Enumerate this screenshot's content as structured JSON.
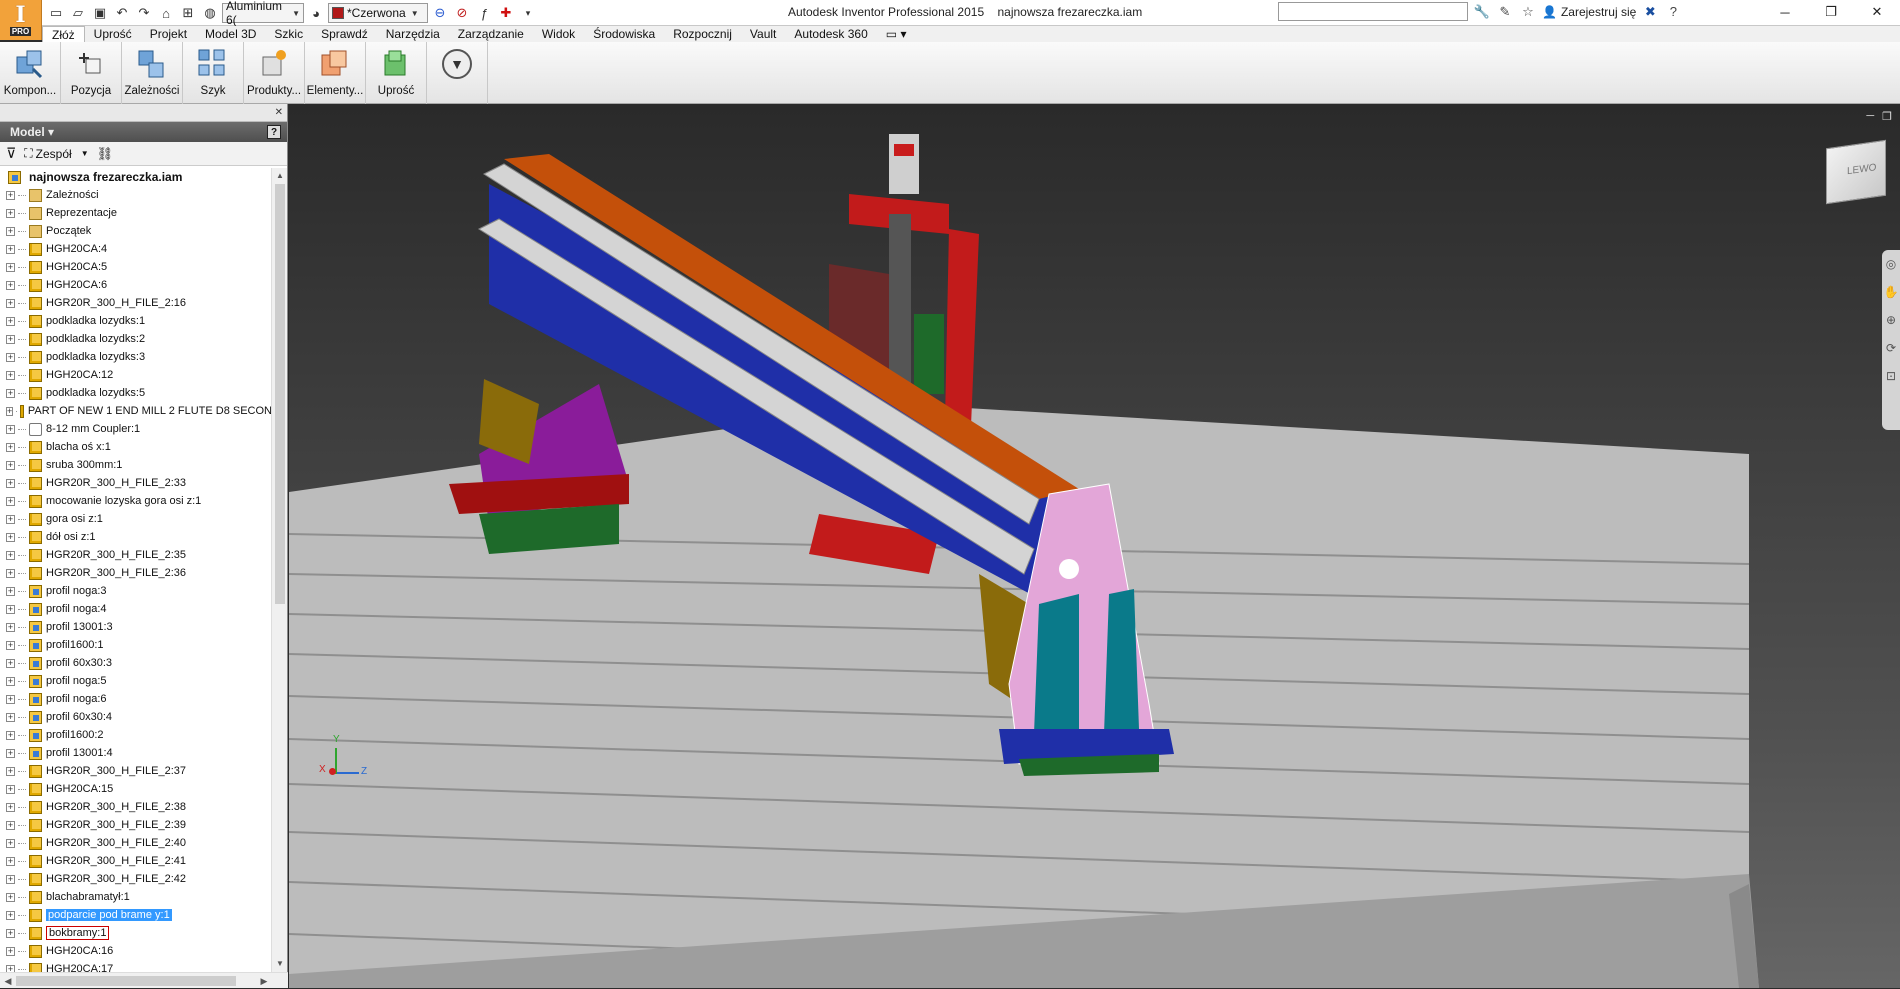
{
  "app": {
    "title": "Autodesk Inventor Professional 2015",
    "document": "najnowsza frezareczka.iam",
    "logo_letter": "I",
    "logo_badge": "PRO"
  },
  "quick_access": {
    "material": "Aluminium 6(",
    "appearance": "*Czerwona",
    "appearance_color": "#b01818"
  },
  "header_right": {
    "search_placeholder": "",
    "signin_label": "Zarejestruj się"
  },
  "menu_tabs": [
    "Złóż",
    "Uprość",
    "Projekt",
    "Model 3D",
    "Szkic",
    "Sprawdź",
    "Narzędzia",
    "Zarządzanie",
    "Widok",
    "Środowiska",
    "Rozpocznij",
    "Vault",
    "Autodesk 360"
  ],
  "active_tab": "Złóż",
  "ribbon": {
    "buttons": [
      {
        "label": "Kompon...",
        "icon": "component-icon"
      },
      {
        "label": "Pozycja",
        "icon": "position-icon"
      },
      {
        "label": "Zależności",
        "icon": "constraints-icon"
      },
      {
        "label": "Szyk",
        "icon": "pattern-icon"
      },
      {
        "label": "Produkty...",
        "icon": "productivity-icon"
      },
      {
        "label": "Elementy...",
        "icon": "features-icon"
      },
      {
        "label": "Uprość",
        "icon": "simplify-icon"
      }
    ]
  },
  "browser": {
    "title": "Model",
    "help": "?",
    "filter_label": "Zespół",
    "root": "najnowsza frezareczka.iam",
    "items": [
      {
        "label": "Zależności",
        "type": "folder"
      },
      {
        "label": "Reprezentacje",
        "type": "folder"
      },
      {
        "label": "Początek",
        "type": "folder"
      },
      {
        "label": "HGH20CA:4",
        "type": "box"
      },
      {
        "label": "HGH20CA:5",
        "type": "box"
      },
      {
        "label": "HGH20CA:6",
        "type": "box"
      },
      {
        "label": "HGR20R_300_H_FILE_2:16",
        "type": "box"
      },
      {
        "label": "podkladka lozydks:1",
        "type": "box"
      },
      {
        "label": "podkladka lozydks:2",
        "type": "box"
      },
      {
        "label": "podkladka lozydks:3",
        "type": "box"
      },
      {
        "label": "HGH20CA:12",
        "type": "box"
      },
      {
        "label": "podkladka lozydks:5",
        "type": "box"
      },
      {
        "label": "PART OF NEW 1 END MILL 2 FLUTE D8 SECON",
        "type": "box"
      },
      {
        "label": "8-12 mm Coupler:1",
        "type": "coupler"
      },
      {
        "label": "blacha oś x:1",
        "type": "box"
      },
      {
        "label": "sruba 300mm:1",
        "type": "box"
      },
      {
        "label": "HGR20R_300_H_FILE_2:33",
        "type": "box"
      },
      {
        "label": "mocowanie lozyska gora osi z:1",
        "type": "box"
      },
      {
        "label": "gora osi z:1",
        "type": "box"
      },
      {
        "label": "dół osi z:1",
        "type": "box"
      },
      {
        "label": "HGR20R_300_H_FILE_2:35",
        "type": "box"
      },
      {
        "label": "HGR20R_300_H_FILE_2:36",
        "type": "box"
      },
      {
        "label": "profil noga:3",
        "type": "asm"
      },
      {
        "label": "profil noga:4",
        "type": "asm"
      },
      {
        "label": "profil 13001:3",
        "type": "asm"
      },
      {
        "label": "profil1600:1",
        "type": "asm"
      },
      {
        "label": "profil 60x30:3",
        "type": "asm"
      },
      {
        "label": "profil noga:5",
        "type": "asm"
      },
      {
        "label": "profil noga:6",
        "type": "asm"
      },
      {
        "label": "profil 60x30:4",
        "type": "asm"
      },
      {
        "label": "profil1600:2",
        "type": "asm"
      },
      {
        "label": "profil 13001:4",
        "type": "asm"
      },
      {
        "label": "HGR20R_300_H_FILE_2:37",
        "type": "box"
      },
      {
        "label": "HGH20CA:15",
        "type": "box"
      },
      {
        "label": "HGR20R_300_H_FILE_2:38",
        "type": "box"
      },
      {
        "label": "HGR20R_300_H_FILE_2:39",
        "type": "box"
      },
      {
        "label": "HGR20R_300_H_FILE_2:40",
        "type": "box"
      },
      {
        "label": "HGR20R_300_H_FILE_2:41",
        "type": "box"
      },
      {
        "label": "HGR20R_300_H_FILE_2:42",
        "type": "box"
      },
      {
        "label": "blachabramatył:1",
        "type": "box"
      },
      {
        "label": "podparcie pod brame y:1",
        "type": "box",
        "state": "selected"
      },
      {
        "label": "bokbramy:1",
        "type": "box",
        "state": "boxed"
      },
      {
        "label": "HGH20CA:16",
        "type": "box"
      },
      {
        "label": "HGH20CA:17",
        "type": "box"
      }
    ]
  },
  "viewport": {
    "viewcube_face": "LEWO",
    "axis_labels": {
      "x": "X",
      "y": "Y",
      "z": "Z"
    },
    "colors": {
      "table": "#bdbdbd",
      "beam_top": "#c4500a",
      "beam_side": "#1f2fa8",
      "rail": "#d4d4d4",
      "plate_pink": "#e3a6d8",
      "z_frame": "#c21b1b",
      "teal": "#0a7a8a",
      "green": "#1e6a2a",
      "olive": "#8a6b0a",
      "purple": "#8a1c9a"
    }
  }
}
